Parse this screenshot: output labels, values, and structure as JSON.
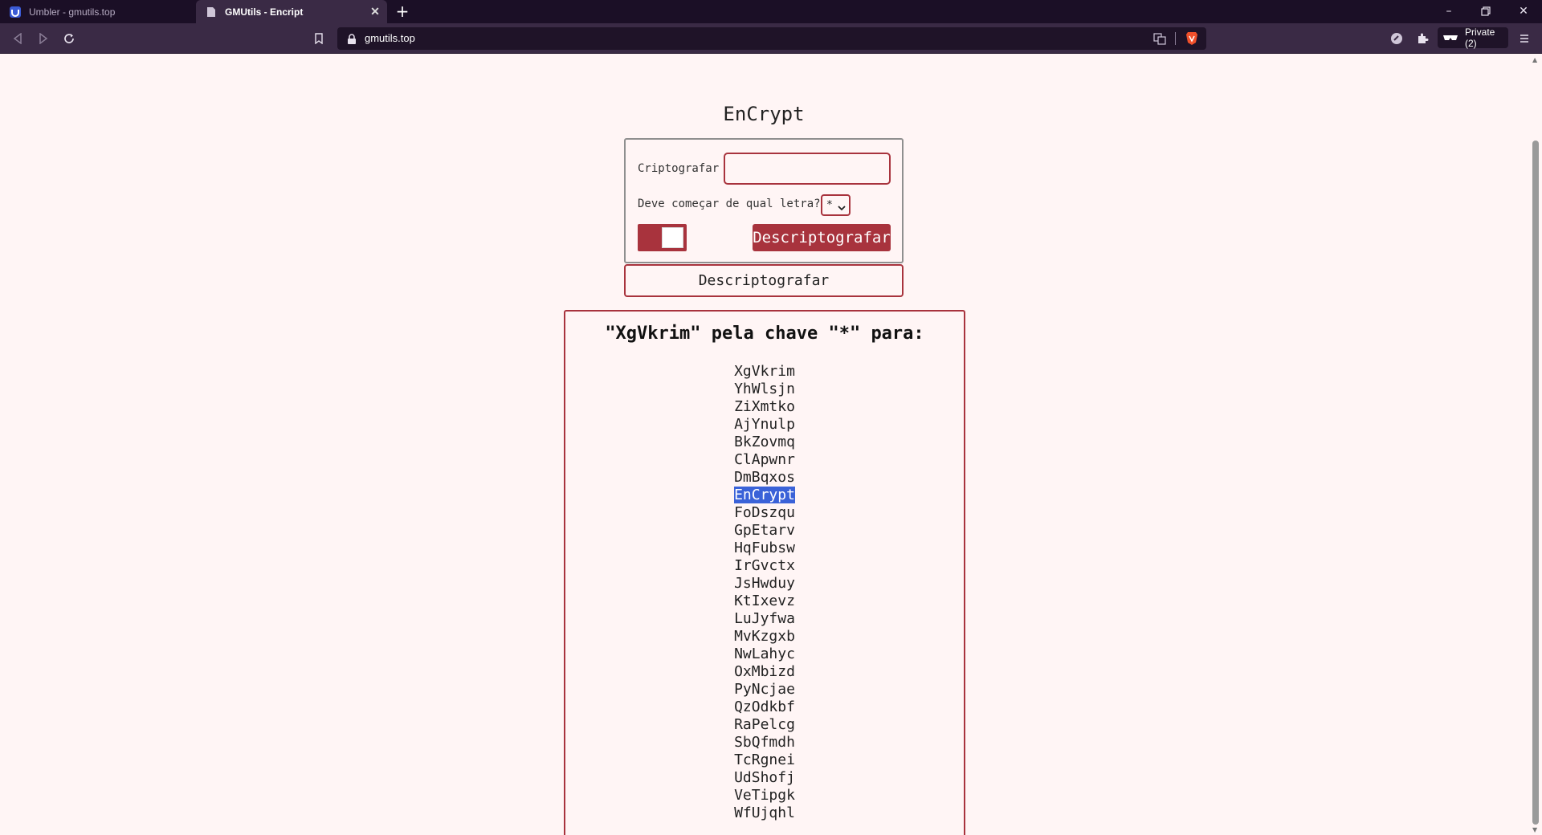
{
  "browser": {
    "tabs": [
      {
        "title": "Umbler - gmutils.top",
        "active": false
      },
      {
        "title": "GMUtils - Encript",
        "active": true
      }
    ],
    "url": "gmutils.top",
    "private_label": "Private (2)"
  },
  "page": {
    "title": "EnCrypt",
    "form": {
      "crypt_label": "Criptografar",
      "crypt_value": "",
      "letter_label": "Deve começar de qual letra?",
      "letter_selected": "*",
      "decrypt_button": "Descriptografar"
    },
    "outline_button": "Descriptografar",
    "result": {
      "heading": "\"XgVkrim\" pela chave \"*\" para:",
      "highlighted": "EnCrypt",
      "items": [
        "XgVkrim",
        "YhWlsjn",
        "ZiXmtko",
        "AjYnulp",
        "BkZovmq",
        "ClApwnr",
        "DmBqxos",
        "EnCrypt",
        "FoDszqu",
        "GpEtarv",
        "HqFubsw",
        "IrGvctx",
        "JsHwduy",
        "KtIxevz",
        "LuJyfwa",
        "MvKzgxb",
        "NwLahyc",
        "OxMbizd",
        "PyNcjae",
        "QzOdkbf",
        "RaPelcg",
        "SbQfmdh",
        "TcRgnei",
        "UdShofj",
        "VeTipgk",
        "WfUjqhl"
      ]
    }
  },
  "colors": {
    "accent": "#a8333d",
    "page_bg": "#fff5f5",
    "chrome_dark": "#1b0f26",
    "chrome_toolbar": "#3a2a45"
  }
}
